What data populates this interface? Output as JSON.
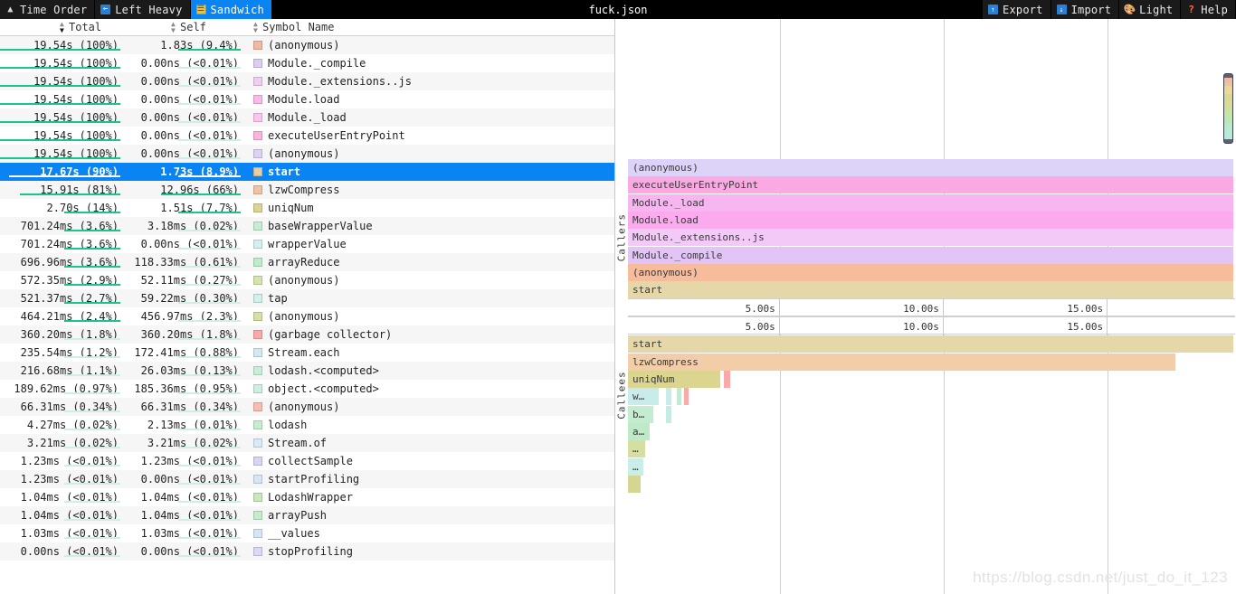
{
  "toolbar": {
    "title": "fuck.json",
    "left_buttons": [
      {
        "label": "Time Order",
        "icon": "time-order-icon",
        "glyph": "▲",
        "active": false
      },
      {
        "label": "Left Heavy",
        "icon": "left-heavy-icon",
        "glyph": "←",
        "active": false
      },
      {
        "label": "Sandwich",
        "icon": "sandwich-icon",
        "glyph": "☰",
        "active": true
      }
    ],
    "right_buttons": [
      {
        "label": "Export",
        "icon": "export-icon",
        "glyph": "↑"
      },
      {
        "label": "Import",
        "icon": "import-icon",
        "glyph": "↓"
      },
      {
        "label": "Light",
        "icon": "palette-icon",
        "glyph": "🎨"
      },
      {
        "label": "Help",
        "icon": "help-icon",
        "glyph": "?"
      }
    ]
  },
  "table": {
    "columns": [
      {
        "label": "Total",
        "sorted": true
      },
      {
        "label": "Self",
        "sorted": false
      },
      {
        "label": "Symbol Name",
        "sorted": false
      }
    ],
    "rows": [
      {
        "total": "19.54s (100%)",
        "self": "1.83s (9.4%)",
        "symbol": "(anonymous)",
        "color": "#f0b9a0",
        "total_bar": 1.0,
        "self_bar": 0.094,
        "selected": false
      },
      {
        "total": "19.54s (100%)",
        "self": "0.00ns (<0.01%)",
        "symbol": "Module._compile",
        "color": "#ddcdf2",
        "total_bar": 1.0,
        "self_bar": 0.0,
        "selected": false
      },
      {
        "total": "19.54s (100%)",
        "self": "0.00ns (<0.01%)",
        "symbol": "Module._extensions..js",
        "color": "#f0cdf2",
        "total_bar": 1.0,
        "self_bar": 0.0,
        "selected": false
      },
      {
        "total": "19.54s (100%)",
        "self": "0.00ns (<0.01%)",
        "symbol": "Module.load",
        "color": "#fbb9ea",
        "total_bar": 1.0,
        "self_bar": 0.0,
        "selected": false
      },
      {
        "total": "19.54s (100%)",
        "self": "0.00ns (<0.01%)",
        "symbol": "Module._load",
        "color": "#fbc4ee",
        "total_bar": 1.0,
        "self_bar": 0.0,
        "selected": false
      },
      {
        "total": "19.54s (100%)",
        "self": "0.00ns (<0.01%)",
        "symbol": "executeUserEntryPoint",
        "color": "#fbb3e0",
        "total_bar": 1.0,
        "self_bar": 0.0,
        "selected": false
      },
      {
        "total": "19.54s (100%)",
        "self": "0.00ns (<0.01%)",
        "symbol": "(anonymous)",
        "color": "#dcd2f5",
        "total_bar": 1.0,
        "self_bar": 0.0,
        "selected": false
      },
      {
        "total": "17.67s (90%)",
        "self": "1.73s (8.9%)",
        "symbol": "start",
        "color": "#e7cfa3",
        "total_bar": 0.9,
        "self_bar": 0.089,
        "selected": true
      },
      {
        "total": "15.91s (81%)",
        "self": "12.96s (66%)",
        "symbol": "lzwCompress",
        "color": "#f0c3a3",
        "total_bar": 0.81,
        "self_bar": 0.66,
        "selected": false
      },
      {
        "total": "2.70s (14%)",
        "self": "1.51s (7.7%)",
        "symbol": "uniqNum",
        "color": "#dbd58f",
        "total_bar": 0.14,
        "self_bar": 0.077,
        "selected": false
      },
      {
        "total": "701.24ms (3.6%)",
        "self": "3.18ms (0.02%)",
        "symbol": "baseWrapperValue",
        "color": "#c6ecd2",
        "total_bar": 0.036,
        "self_bar": 0.0002,
        "selected": false
      },
      {
        "total": "701.24ms (3.6%)",
        "self": "0.00ns (<0.01%)",
        "symbol": "wrapperValue",
        "color": "#d4f0ee",
        "total_bar": 0.036,
        "self_bar": 0.0,
        "selected": false
      },
      {
        "total": "696.96ms (3.6%)",
        "self": "118.33ms (0.61%)",
        "symbol": "arrayReduce",
        "color": "#bdecca",
        "total_bar": 0.036,
        "self_bar": 0.0061,
        "selected": false
      },
      {
        "total": "572.35ms (2.9%)",
        "self": "52.11ms (0.27%)",
        "symbol": "(anonymous)",
        "color": "#d4e4ab",
        "total_bar": 0.029,
        "self_bar": 0.0027,
        "selected": false
      },
      {
        "total": "521.37ms (2.7%)",
        "self": "59.22ms (0.30%)",
        "symbol": "tap",
        "color": "#d0f0ea",
        "total_bar": 0.027,
        "self_bar": 0.003,
        "selected": false
      },
      {
        "total": "464.21ms (2.4%)",
        "self": "456.97ms (2.3%)",
        "symbol": "(anonymous)",
        "color": "#d7dfa4",
        "total_bar": 0.024,
        "self_bar": 0.023,
        "selected": false
      },
      {
        "total": "360.20ms (1.8%)",
        "self": "360.20ms (1.8%)",
        "symbol": "(garbage collector)",
        "color": "#fba8a8",
        "total_bar": 0.018,
        "self_bar": 0.018,
        "selected": false
      },
      {
        "total": "235.54ms (1.2%)",
        "self": "172.41ms (0.88%)",
        "symbol": "Stream.each",
        "color": "#d4eaf2",
        "total_bar": 0.012,
        "self_bar": 0.0088,
        "selected": false
      },
      {
        "total": "216.68ms (1.1%)",
        "self": "26.03ms (0.13%)",
        "symbol": "lodash.<computed>",
        "color": "#caeddb",
        "total_bar": 0.011,
        "self_bar": 0.0013,
        "selected": false
      },
      {
        "total": "189.62ms (0.97%)",
        "self": "185.36ms (0.95%)",
        "symbol": "object.<computed>",
        "color": "#cfefe2",
        "total_bar": 0.0097,
        "self_bar": 0.0095,
        "selected": false
      },
      {
        "total": "66.31ms (0.34%)",
        "self": "66.31ms (0.34%)",
        "symbol": "(anonymous)",
        "color": "#fbbcb0",
        "total_bar": 0.0034,
        "self_bar": 0.0034,
        "selected": false
      },
      {
        "total": "4.27ms (0.02%)",
        "self": "2.13ms (0.01%)",
        "symbol": "lodash",
        "color": "#c6edcf",
        "total_bar": 0.0002,
        "self_bar": 0.0001,
        "selected": false
      },
      {
        "total": "3.21ms (0.02%)",
        "self": "3.21ms (0.02%)",
        "symbol": "Stream.of",
        "color": "#d8eaf5",
        "total_bar": 0.0002,
        "self_bar": 0.0002,
        "selected": false
      },
      {
        "total": "1.23ms (<0.01%)",
        "self": "1.23ms (<0.01%)",
        "symbol": "collectSample",
        "color": "#d7d4f5",
        "total_bar": 0.0001,
        "self_bar": 0.0001,
        "selected": false
      },
      {
        "total": "1.23ms (<0.01%)",
        "self": "0.00ns (<0.01%)",
        "symbol": "startProfiling",
        "color": "#d7e6f5",
        "total_bar": 0.0001,
        "self_bar": 0.0,
        "selected": false
      },
      {
        "total": "1.04ms (<0.01%)",
        "self": "1.04ms (<0.01%)",
        "symbol": "LodashWrapper",
        "color": "#c9e8bb",
        "total_bar": 0.0001,
        "self_bar": 0.0001,
        "selected": false
      },
      {
        "total": "1.04ms (<0.01%)",
        "self": "1.04ms (<0.01%)",
        "symbol": "arrayPush",
        "color": "#c6eccc",
        "total_bar": 0.0001,
        "self_bar": 0.0001,
        "selected": false
      },
      {
        "total": "1.03ms (<0.01%)",
        "self": "1.03ms (<0.01%)",
        "symbol": "__values",
        "color": "#d5e7f7",
        "total_bar": 0.0001,
        "self_bar": 0.0001,
        "selected": false
      },
      {
        "total": "0.00ns (<0.01%)",
        "self": "0.00ns (<0.01%)",
        "symbol": "stopProfiling",
        "color": "#d9d9f7",
        "total_bar": 0.0,
        "self_bar": 0.0,
        "selected": false
      }
    ]
  },
  "sandwich": {
    "callers_label": "Callers",
    "callees_label": "Callees",
    "ruler_ticks": [
      "5.00s",
      "10.00s",
      "15.00s"
    ],
    "callers_rows": [
      {
        "label": "(anonymous)",
        "color": "#ddd2f7",
        "width": 1.0
      },
      {
        "label": "executeUserEntryPoint",
        "color": "#fba9e2",
        "width": 1.0
      },
      {
        "label": "Module._load",
        "color": "#f8b6f0",
        "width": 1.0
      },
      {
        "label": "Module.load",
        "color": "#fbaaee",
        "width": 1.0
      },
      {
        "label": "Module._extensions..js",
        "color": "#f2c9f7",
        "width": 1.0
      },
      {
        "label": "Module._compile",
        "color": "#e2c4f7",
        "width": 1.0
      },
      {
        "label": "(anonymous)",
        "color": "#f7bc9b",
        "width": 1.0
      },
      {
        "label": "start",
        "color": "#e6d7a8",
        "width": 1.0
      }
    ],
    "callees_rows": [
      [
        {
          "label": "start",
          "color": "#e6d7a8",
          "x": 0.0,
          "w": 1.0
        }
      ],
      [
        {
          "label": "lzwCompress",
          "color": "#f3cda8",
          "x": 0.0,
          "w": 0.905
        }
      ],
      [
        {
          "label": "uniqNum",
          "color": "#dbd58f",
          "x": 0.0,
          "w": 0.155
        },
        {
          "label": "",
          "color": "#fba8a8",
          "x": 0.158,
          "w": 0.014
        }
      ],
      [
        {
          "label": "w…",
          "color": "#c9ebea",
          "x": 0.0,
          "w": 0.054
        },
        {
          "label": "",
          "color": "#c9ebea",
          "x": 0.062,
          "w": 0.012
        },
        {
          "label": "",
          "color": "#c3ead5",
          "x": 0.08,
          "w": 0.01
        },
        {
          "label": "",
          "color": "#fbaaaa",
          "x": 0.093,
          "w": 0.005
        }
      ],
      [
        {
          "label": "b…",
          "color": "#c4ecd1",
          "x": 0.0,
          "w": 0.044
        },
        {
          "label": "",
          "color": "#c4ece2",
          "x": 0.062,
          "w": 0.012
        }
      ],
      [
        {
          "label": "a…",
          "color": "#bfeac8",
          "x": 0.0,
          "w": 0.039
        }
      ],
      [
        {
          "label": "…",
          "color": "#d5dfa2",
          "x": 0.0,
          "w": 0.031
        }
      ],
      [
        {
          "label": "…",
          "color": "#c9eee7",
          "x": 0.0,
          "w": 0.028
        }
      ],
      [
        {
          "label": "",
          "color": "#d5d692",
          "x": 0.0,
          "w": 0.024
        }
      ]
    ],
    "minimap_segments": [
      "#5c6272",
      "#f0b9a0",
      "#e8c59a",
      "#f2d49a",
      "#e8dc96",
      "#ddd894",
      "#dbd98f",
      "#d6dd96",
      "#cfe09c",
      "#c8e3a4",
      "#c2e6ac",
      "#bde8b6",
      "#b9eac1",
      "#b6ebcc",
      "#b4ecd6",
      "#b3ecdf",
      "#5c6272"
    ]
  },
  "watermark": "https://blog.csdn.net/just_do_it_123"
}
